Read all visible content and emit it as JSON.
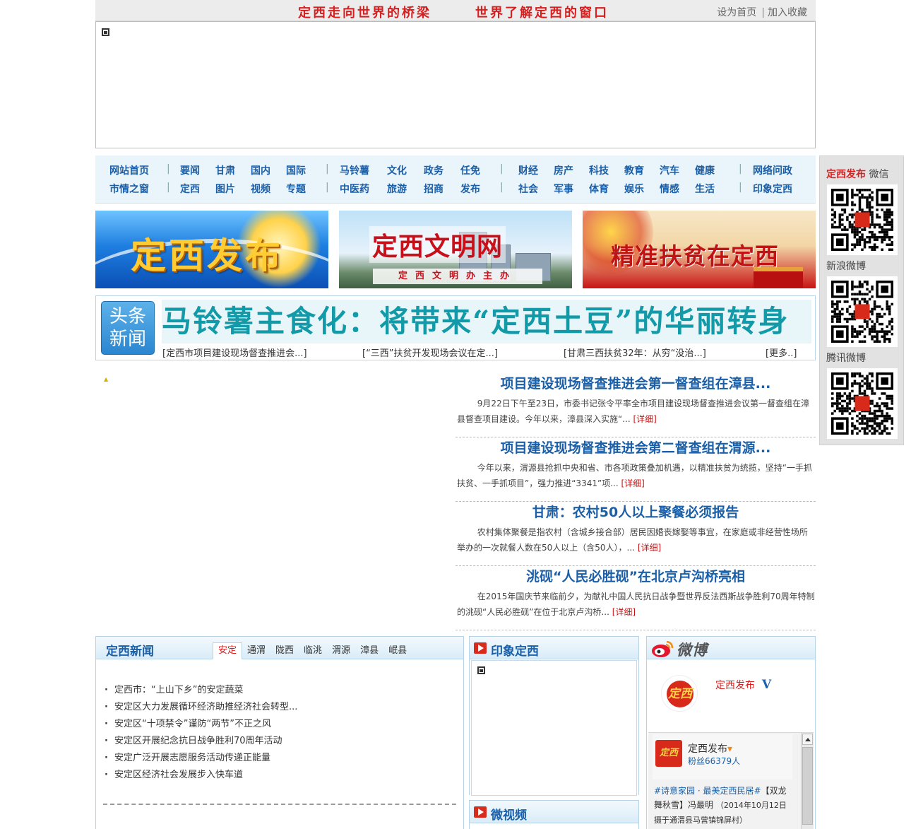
{
  "top": {
    "slogan1": "定西走向世界的桥梁",
    "slogan2": "世界了解定西的窗口",
    "set_home": "设为首页",
    "separator": "|",
    "add_fav": "加入收藏"
  },
  "nav": {
    "row1": [
      "网站首页",
      "要闻",
      "甘肃",
      "国内",
      "国际",
      "马铃薯",
      "文化",
      "政务",
      "任免",
      "财经",
      "房产",
      "科技",
      "教育",
      "汽车",
      "健康",
      "网络问政"
    ],
    "row2": [
      "市情之窗",
      "定西",
      "图片",
      "视频",
      "专题",
      "中医药",
      "旅游",
      "招商",
      "发布",
      "社会",
      "军事",
      "体育",
      "娱乐",
      "情感",
      "生活",
      "印象定西"
    ],
    "bar": "|"
  },
  "banners": {
    "b1": "定西发布",
    "b2_title": "定西文明网",
    "b2_sub": "定西文明办主办",
    "b3": "精准扶贫在定西"
  },
  "headline": {
    "badge_line1": "头条",
    "badge_line2": "新闻",
    "title": "马铃薯主食化：将带来“定西土豆”的华丽转身",
    "links": [
      "[定西市项目建设现场督查推进会...]",
      "[“三西”扶贫开发现场会议在定...]",
      "[甘肃三西扶贫32年：从穷“没治...]",
      "[更多..]"
    ]
  },
  "news": [
    {
      "title": "项目建设现场督查推进会第一督查组在漳县...",
      "desc": "9月22日下午至23日，市委书记张令平率全市项目建设现场督查推进会议第一督查组在漳县督查项目建设。今年以来，漳县深入实施“...",
      "more": "[详细]"
    },
    {
      "title": "项目建设现场督查推进会第二督查组在渭源...",
      "desc": "今年以来，渭源县抢抓中央和省、市各项政策叠加机遇，以精准扶贫为统揽，坚持“一手抓扶贫、一手抓项目”，强力推进“3341”项...",
      "more": "[详细]"
    },
    {
      "title": "甘肃：农村50人以上聚餐必须报告",
      "desc": "农村集体聚餐是指农村（含城乡接合部）居民因婚丧嫁娶等事宜，在家庭或非经营性场所举办的一次就餐人数在50人以上（含50人），...",
      "more": "[详细]"
    },
    {
      "title": "洮砚“人民必胜砚”在北京卢沟桥亮相",
      "desc": "在2015年国庆节来临前夕，为献礼中国人民抗日战争暨世界反法西斯战争胜利70周年特制的洮砚“人民必胜砚”在位于北京卢沟桥...",
      "more": "[详细]"
    }
  ],
  "qr": {
    "wechat_name": "定西发布",
    "wechat_suffix": "微信",
    "sina": "新浪微博",
    "tencent": "腾讯微博"
  },
  "dingxi_news": {
    "title": "定西新闻",
    "tabs": [
      "安定",
      "通渭",
      "陇西",
      "临洮",
      "渭源",
      "漳县",
      "岷县"
    ],
    "active_tab": 0,
    "items": [
      "定西市：“上山下乡”的安定蔬菜",
      "安定区大力发展循环经济助推经济社会转型...",
      "安定区“十项禁令”谨防“两节”不正之风",
      "安定区开展纪念抗日战争胜利70周年活动",
      "安定广泛开展志愿服务活动传递正能量",
      "安定区经济社会发展步入快车道"
    ]
  },
  "impression": {
    "title": "印象定西",
    "micro_video": "微视频"
  },
  "weibo": {
    "brand": "微博",
    "seal_text": "定西",
    "account": "定西发布",
    "vmark": "V",
    "feed_name": "定西发布",
    "fans": "粉丝66379人",
    "post_tag": "#诗意家园 · 最美定西民居#",
    "post_text": "【双龙舞秋雪】冯最明",
    "post_meta": "（2014年10月12日摄于通渭县马营镇锦屏村）"
  },
  "colors": {
    "accent_red": "#d81e1e",
    "link_blue": "#1a5fa8",
    "headline_teal": "#139aa8"
  }
}
